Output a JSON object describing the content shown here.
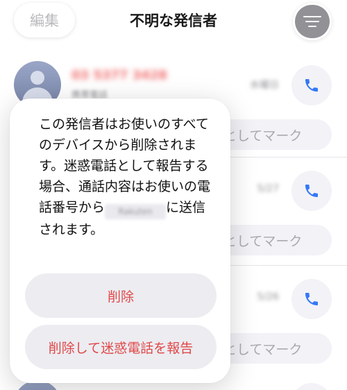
{
  "header": {
    "edit_label": "編集",
    "title": "不明な発信者"
  },
  "rows": [
    {
      "number": "03 5377 3428",
      "sub": "携帯電話",
      "time": "水曜日"
    },
    {
      "number": "",
      "sub": "",
      "time": "5/27"
    },
    {
      "number": "",
      "sub": "",
      "time": "5/26"
    }
  ],
  "mark_label": "としてマーク",
  "popover": {
    "line1": "この発信者はお使いのすべてのデバイスから削除されます。迷惑電話として報告する場合、通話内容はお使いの電話番号から",
    "redacted": "Rakuten",
    "line2": "に送信されます。",
    "delete_label": "削除",
    "report_label": "削除して迷惑電話を報告"
  },
  "colors": {
    "accent": "#3478f6",
    "destructive": "#e04848",
    "filter_bg": "#919196"
  },
  "icons": {
    "phone": "phone-icon",
    "filter": "filter-icon",
    "avatar": "person-icon"
  }
}
